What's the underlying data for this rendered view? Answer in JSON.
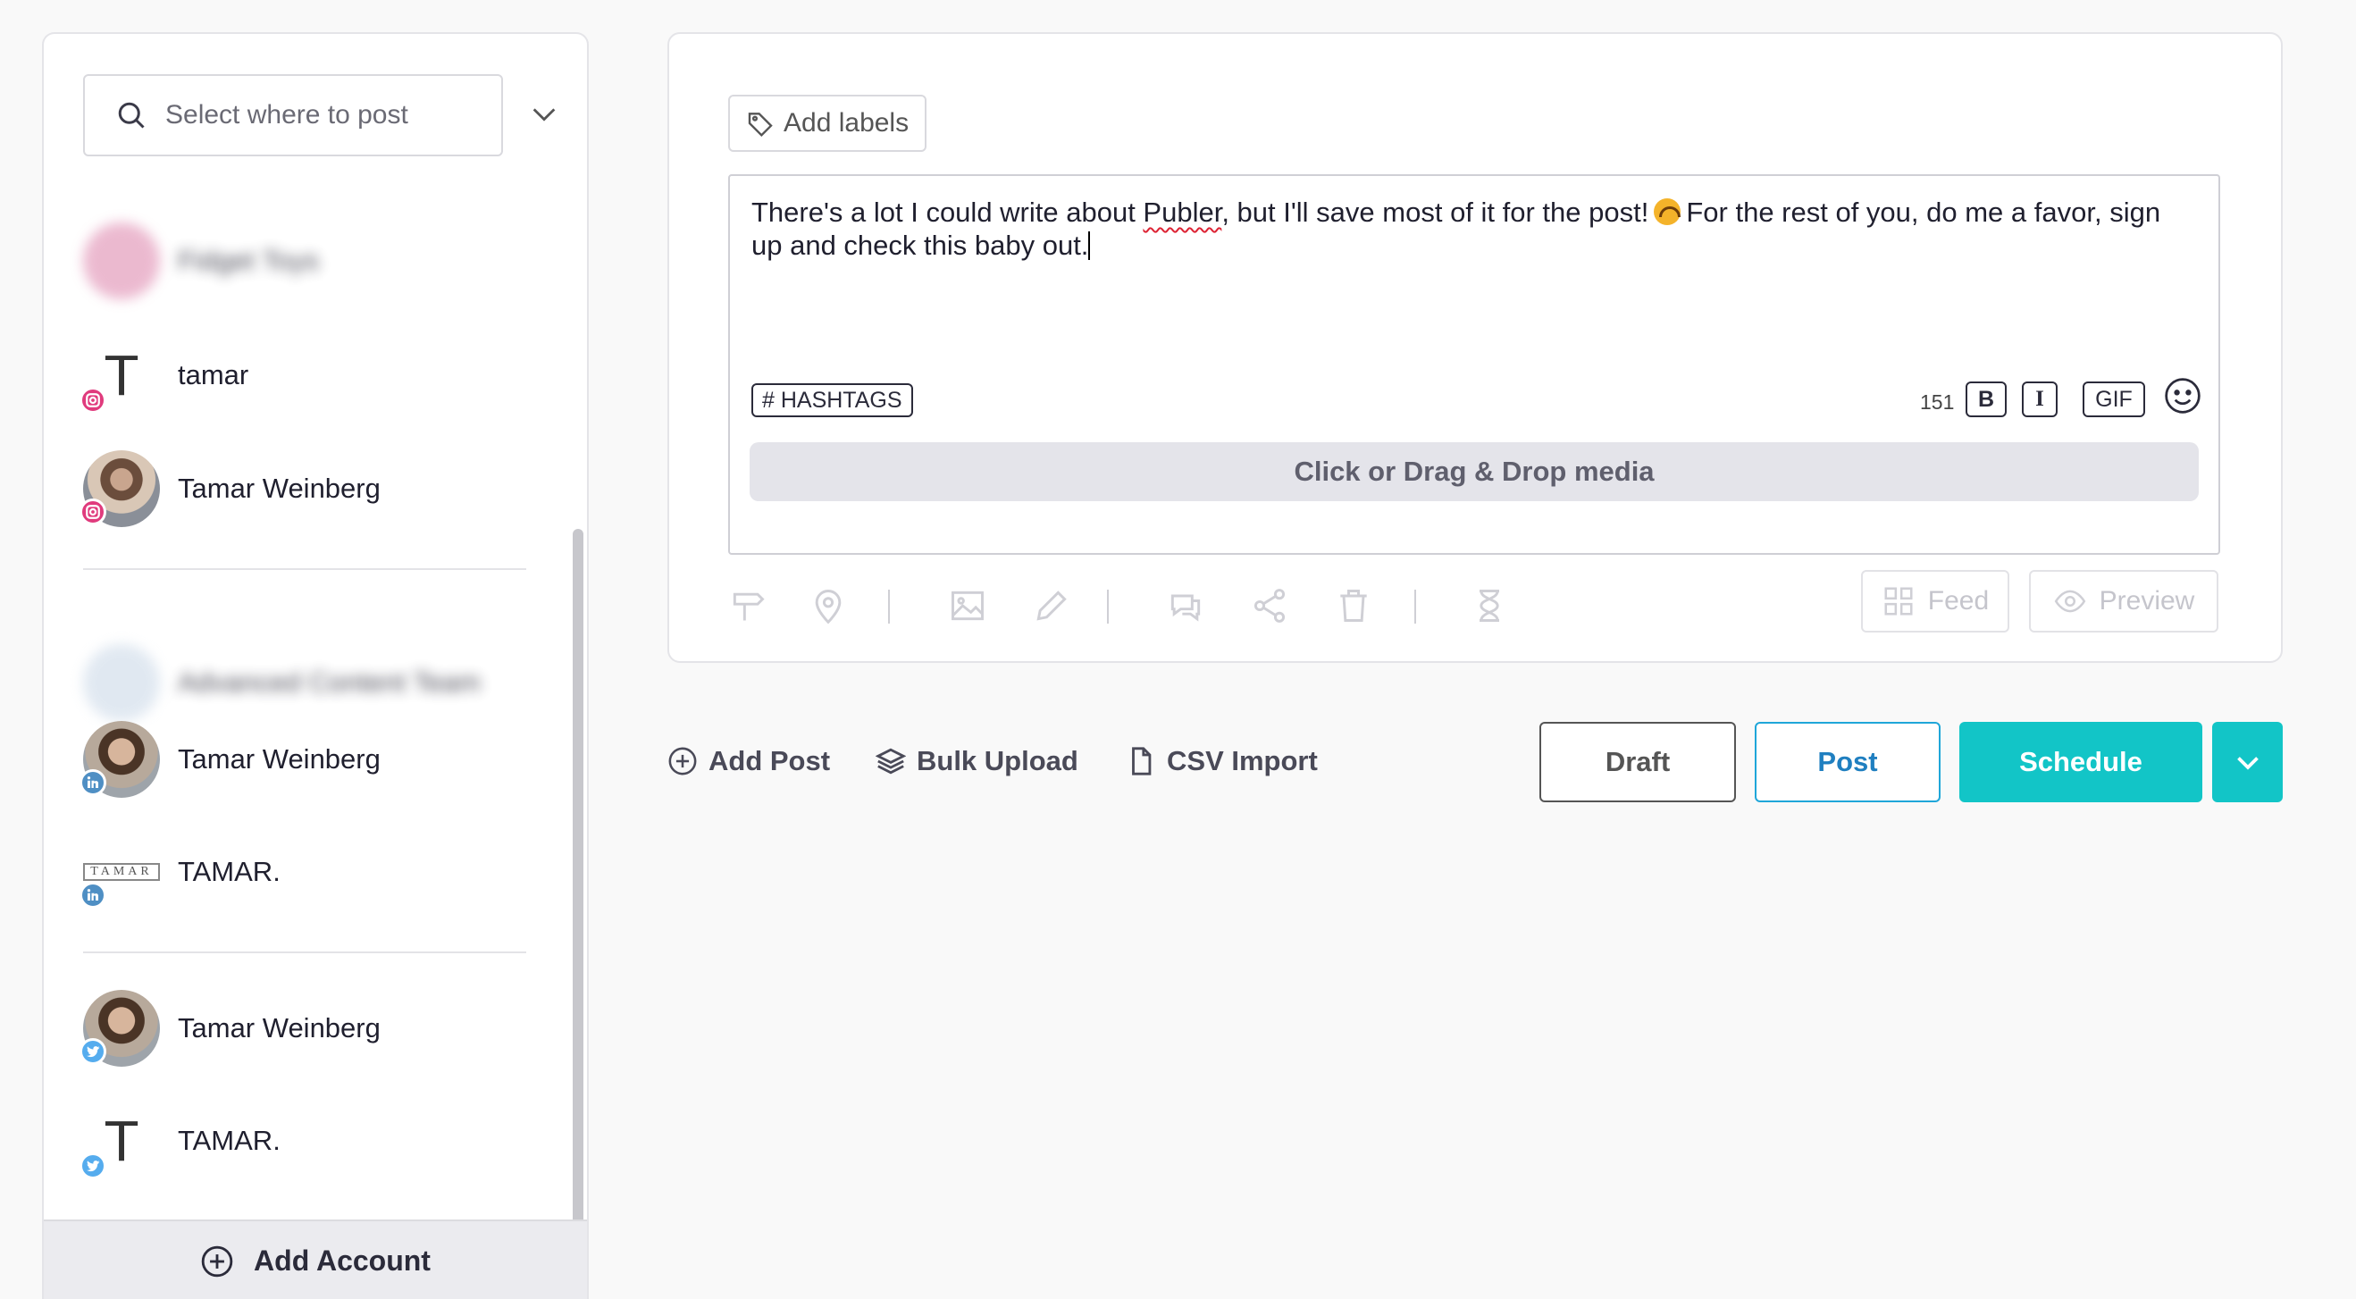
{
  "sidebar": {
    "search_placeholder": "Select where to post",
    "accounts": [
      {
        "name": "Fidget Toys",
        "network": "instagram",
        "blurred": true,
        "avatar_letter": ""
      },
      {
        "name": "tamar",
        "network": "instagram",
        "blurred": false,
        "avatar_letter": "T"
      },
      {
        "name": "Tamar Weinberg",
        "network": "instagram",
        "blurred": false,
        "avatar_letter": ""
      },
      {
        "name": "Advanced Content Team",
        "network": "twitter",
        "blurred": true,
        "avatar_letter": ""
      },
      {
        "name": "Tamar Weinberg",
        "network": "linkedin",
        "blurred": false,
        "avatar_letter": ""
      },
      {
        "name": "TAMAR.",
        "network": "linkedin",
        "blurred": false,
        "avatar_letter": "TAMAR"
      },
      {
        "name": "Tamar Weinberg",
        "network": "twitter",
        "blurred": false,
        "avatar_letter": ""
      },
      {
        "name": "TAMAR.",
        "network": "twitter",
        "blurred": false,
        "avatar_letter": "T"
      }
    ],
    "add_account_label": "Add Account"
  },
  "composer": {
    "add_labels": "Add labels",
    "post_text_part1": "There's a lot I could write about ",
    "post_text_misspelled": "Publer",
    "post_text_part2": ", but I'll save most of it for the post!",
    "post_text_part3": "For the rest of you, do me a favor, sign up and check this baby out.",
    "hashtags_label": "# HASHTAGS",
    "char_count": "151",
    "bold_label": "B",
    "italic_label": "I",
    "gif_label": "GIF",
    "dropzone_label": "Click or Drag & Drop media",
    "feed_label": "Feed",
    "preview_label": "Preview"
  },
  "actions": {
    "add_post": "Add Post",
    "bulk_upload": "Bulk Upload",
    "csv_import": "CSV Import",
    "draft": "Draft",
    "post": "Post",
    "schedule": "Schedule"
  },
  "colors": {
    "accent": "#12c5c7",
    "post_border": "#1fa6d9",
    "instagram": "#e03b7d",
    "linkedin": "#4f8fc4",
    "twitter": "#55acee"
  }
}
